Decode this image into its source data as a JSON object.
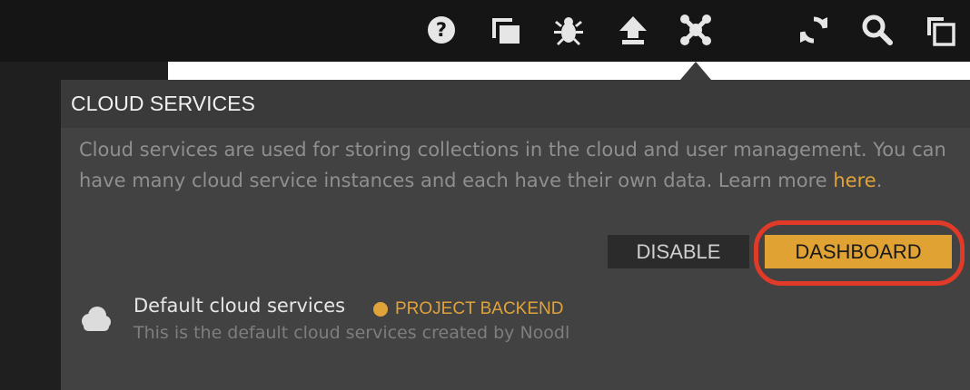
{
  "toolbar": {
    "icons": [
      "help-icon",
      "windows-icon",
      "bug-icon",
      "upload-icon",
      "cloud-services-icon",
      "refresh-icon",
      "search-icon",
      "copy-icon"
    ]
  },
  "panel": {
    "title": "CLOUD SERVICES",
    "description": "Cloud services are used for storing collections in the cloud and user management. You can have many cloud service instances and each have their own data. Learn more ",
    "link_text": "here",
    "link_suffix": ".",
    "disable_label": "DISABLE",
    "dashboard_label": "DASHBOARD"
  },
  "service": {
    "name": "Default cloud services",
    "badge": "PROJECT BACKEND",
    "description": "This is the default cloud services created by Noodl"
  },
  "colors": {
    "accent": "#dfa233",
    "highlight": "#e23a28",
    "panel_bg": "#424242",
    "toolbar_bg": "#151515"
  }
}
